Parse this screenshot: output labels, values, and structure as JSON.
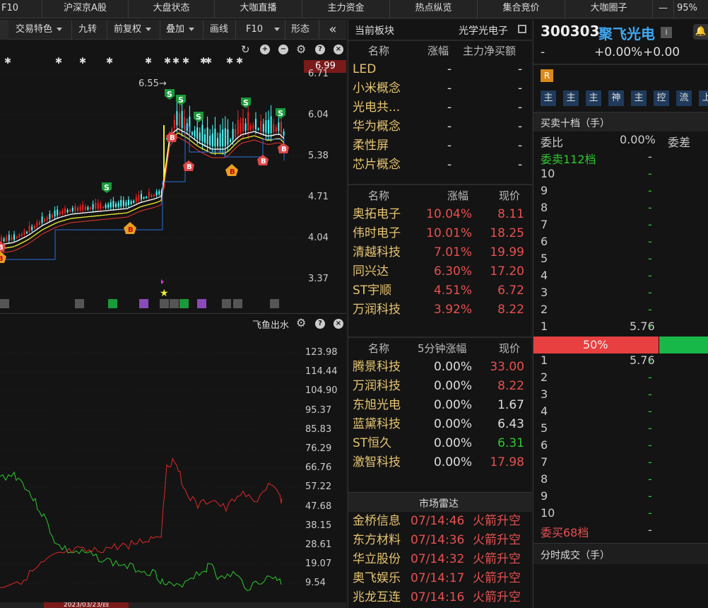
{
  "topnav": {
    "items": [
      "F10",
      "沪深京A股",
      "大盘状态",
      "大咖直播",
      "主力资金",
      "热点纵览",
      "集合竞价",
      "大咖圈子"
    ],
    "minimize": "—",
    "zoom": "95%"
  },
  "toolbar": {
    "items": [
      "交易特色",
      "九转",
      "前复权",
      "叠加",
      "画线",
      "F10",
      "形态"
    ]
  },
  "kline": {
    "price_labels": [
      "6.71",
      "6.04",
      "5.38",
      "4.71",
      "4.04",
      "3.37"
    ],
    "current_price_badge": "6.99",
    "high_marker": "6.55→"
  },
  "lower_chart": {
    "title": "飞鱼出水",
    "price_labels": [
      "123.98",
      "114.44",
      "104.90",
      "95.37",
      "85.83",
      "76.29",
      "66.76",
      "57.22",
      "47.68",
      "38.15",
      "28.61",
      "19.07",
      "9.54"
    ],
    "date_label": "2023/03/23/四"
  },
  "sector": {
    "title": "当前板块",
    "current_sector": "光学光电子",
    "headers": [
      "名称",
      "涨幅",
      "主力净买额"
    ],
    "rows": [
      {
        "name": "LED",
        "chg": "-",
        "net": "-"
      },
      {
        "name": "小米概念",
        "chg": "-",
        "net": "-"
      },
      {
        "name": "光电共...",
        "chg": "-",
        "net": "-"
      },
      {
        "name": "华为概念",
        "chg": "-",
        "net": "-"
      },
      {
        "name": "柔性屏",
        "chg": "-",
        "net": "-"
      },
      {
        "name": "芯片概念",
        "chg": "-",
        "net": "-"
      }
    ]
  },
  "stocks1": {
    "headers": [
      "名称",
      "涨幅",
      "现价"
    ],
    "rows": [
      {
        "name": "奥拓电子",
        "chg": "10.04%",
        "price": "8.11"
      },
      {
        "name": "伟时电子",
        "chg": "10.01%",
        "price": "18.25"
      },
      {
        "name": "清越科技",
        "chg": "7.01%",
        "price": "19.99"
      },
      {
        "name": "同兴达",
        "chg": "6.30%",
        "price": "17.20"
      },
      {
        "name": "ST宇顺",
        "chg": "4.51%",
        "price": "6.72"
      },
      {
        "name": "万润科技",
        "chg": "3.92%",
        "price": "8.22"
      }
    ]
  },
  "stocks2": {
    "headers": [
      "名称",
      "5分钟涨幅",
      "现价"
    ],
    "rows": [
      {
        "name": "腾景科技",
        "chg": "0.00%",
        "price": "33.00",
        "color": "red"
      },
      {
        "name": "万润科技",
        "chg": "0.00%",
        "price": "8.22",
        "color": "red"
      },
      {
        "name": "东旭光电",
        "chg": "0.00%",
        "price": "1.67",
        "color": "white"
      },
      {
        "name": "蓝黛科技",
        "chg": "0.00%",
        "price": "6.43",
        "color": "white"
      },
      {
        "name": "ST恒久",
        "chg": "0.00%",
        "price": "6.31",
        "color": "green"
      },
      {
        "name": "激智科技",
        "chg": "0.00%",
        "price": "17.98",
        "color": "red"
      }
    ]
  },
  "radar": {
    "title": "市场雷达",
    "rows": [
      {
        "name": "金桥信息",
        "time": "07/14:46",
        "event": "火箭升空"
      },
      {
        "name": "东方材料",
        "time": "07/14:36",
        "event": "火箭升空"
      },
      {
        "name": "华立股份",
        "time": "07/14:32",
        "event": "火箭升空"
      },
      {
        "name": "奥飞娱乐",
        "time": "07/14:17",
        "event": "火箭升空"
      },
      {
        "name": "兆龙互连",
        "time": "07/14:16",
        "event": "火箭升空"
      }
    ]
  },
  "quote": {
    "code": "300303",
    "name": "聚飞光电",
    "price": "-",
    "chg_pct": "+0.00%",
    "chg": "+0.00",
    "r_badge": "R",
    "tags": [
      "主",
      "主",
      "主",
      "神",
      "主",
      "控",
      "流",
      "上"
    ],
    "book_title": "买卖十档（手）",
    "weibi_label": "委比",
    "weibi_value": "0.00%",
    "weicha_label": "委差",
    "sell_title": "委卖112档",
    "sell_title_val": "-",
    "sell_levels": [
      {
        "lvl": "10",
        "price": "",
        "vol": "-"
      },
      {
        "lvl": "9",
        "price": "",
        "vol": "-"
      },
      {
        "lvl": "8",
        "price": "",
        "vol": "-"
      },
      {
        "lvl": "7",
        "price": "",
        "vol": "-"
      },
      {
        "lvl": "6",
        "price": "",
        "vol": "-"
      },
      {
        "lvl": "5",
        "price": "",
        "vol": "-"
      },
      {
        "lvl": "4",
        "price": "",
        "vol": "-"
      },
      {
        "lvl": "3",
        "price": "",
        "vol": "-"
      },
      {
        "lvl": "2",
        "price": "",
        "vol": "-"
      },
      {
        "lvl": "1",
        "price": "5.76",
        "vol": "-"
      }
    ],
    "ratio_label": "50%",
    "buy_levels": [
      {
        "lvl": "1",
        "price": "5.76",
        "vol": "-"
      },
      {
        "lvl": "2",
        "price": "",
        "vol": "-"
      },
      {
        "lvl": "3",
        "price": "",
        "vol": "-"
      },
      {
        "lvl": "4",
        "price": "",
        "vol": "-"
      },
      {
        "lvl": "5",
        "price": "",
        "vol": "-"
      },
      {
        "lvl": "6",
        "price": "",
        "vol": "-"
      },
      {
        "lvl": "7",
        "price": "",
        "vol": "-"
      },
      {
        "lvl": "8",
        "price": "",
        "vol": "-"
      },
      {
        "lvl": "9",
        "price": "",
        "vol": "-"
      },
      {
        "lvl": "10",
        "price": "",
        "vol": "-"
      }
    ],
    "buy_title": "委买68档",
    "buy_title_val": "-",
    "ticks_title": "分时成交（手）"
  },
  "colors": {
    "up": "#e85050",
    "down": "#2ec82e",
    "name": "#e6c470",
    "accent": "#3fa9f5"
  }
}
